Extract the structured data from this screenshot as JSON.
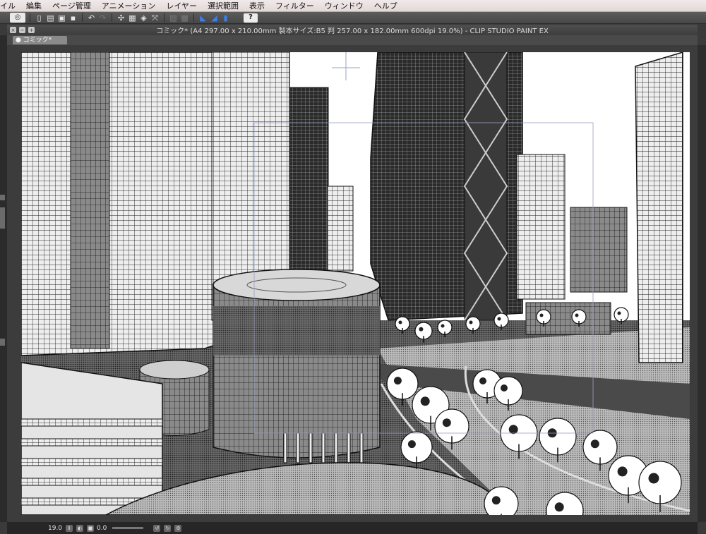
{
  "menubar": {
    "items": [
      "イル",
      "編集",
      "ページ管理",
      "アニメーション",
      "レイヤー",
      "選択範囲",
      "表示",
      "フィルター",
      "ウィンドウ",
      "ヘルプ"
    ]
  },
  "toolbar": {
    "icons": [
      "csp-logo-icon",
      "new-file-icon",
      "open-file-icon",
      "save-icon",
      "layer-icon",
      "undo-icon",
      "redo-icon",
      "transform-icon",
      "fill-icon",
      "fill-bucket-icon",
      "move-icon",
      "deselect-icon",
      "select-all-icon",
      "ruler-icon",
      "shape-ruler-icon",
      "pen-icon",
      "help-icon"
    ],
    "help_label": "?"
  },
  "window": {
    "title": "コミック* (A4 297.00 x 210.00mm 製本サイズ:B5 判 257.00 x 182.00mm 600dpi 19.0%)  - CLIP STUDIO PAINT EX",
    "tab_label": "コミック*"
  },
  "status": {
    "zoom": "19.0",
    "angle": "0.0"
  },
  "colors": {
    "canvas_bg": "#ffffff",
    "ui_dark": "#3a3a3a",
    "menubar": "#ede4e4",
    "accent_blue": "#3f7fe6"
  },
  "canvas": {
    "content": "manga-style city scene"
  }
}
